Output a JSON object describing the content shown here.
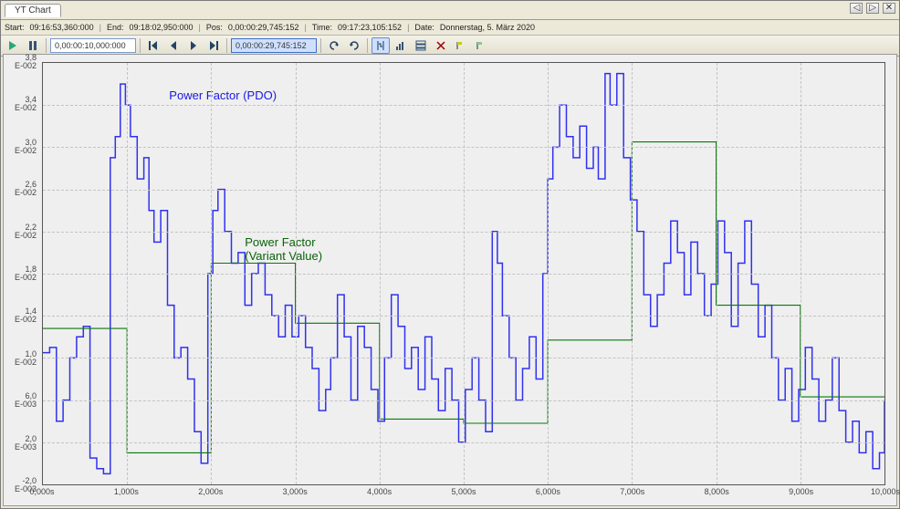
{
  "tab": {
    "title": "YT Chart"
  },
  "wincontrols": {
    "left": "◁",
    "right": "▷",
    "close": "✕"
  },
  "info": {
    "start_label": "Start:",
    "start_value": "09:16:53,360:000",
    "end_label": "End:",
    "end_value": "09:18:02,950:000",
    "pos_label": "Pos:",
    "pos_value": "0,00:00:29,745:152",
    "time_label": "Time:",
    "time_value": "09:17:23,105:152",
    "date_label": "Date:",
    "date_value": "Donnerstag, 5. März 2020"
  },
  "toolbar": {
    "field1": "0,00:00:10,000:000",
    "field2": "0,00:00:29,745:152",
    "icons": {
      "play": "run-icon",
      "pause": "pause-icon",
      "first": "goto-start-icon",
      "prev": "step-back-icon",
      "next": "step-fwd-icon",
      "last": "goto-end-icon",
      "undo": "undo-icon",
      "redo": "redo-icon",
      "cursor": "cursor-toggle-icon",
      "chart1": "overview-icon",
      "chart2": "stack-icon",
      "xmark": "clear-marks-icon",
      "tool1": "marker-a-icon",
      "tool2": "marker-b-icon"
    }
  },
  "annotations": {
    "pdo": "Power Factor (PDO)",
    "variant": "Power Factor\n(Variant Value)"
  },
  "chart_data": {
    "type": "line",
    "xlabel": "",
    "ylabel": "",
    "xlim": [
      0,
      10000
    ],
    "ylim": [
      -0.002,
      0.038
    ],
    "x_ticks": [
      "0,000s",
      "1,000s",
      "2,000s",
      "3,000s",
      "4,000s",
      "5,000s",
      "6,000s",
      "7,000s",
      "8,000s",
      "9,000s",
      "10,000s"
    ],
    "y_ticks": [
      "-2,0\nE-003",
      "2,0\nE-003",
      "6,0\nE-003",
      "1,0\nE-002",
      "1,4\nE-002",
      "1,8\nE-002",
      "2,2\nE-002",
      "2,6\nE-002",
      "3,0\nE-002",
      "3,4\nE-002",
      "3,8\nE-002"
    ],
    "y_tick_values": [
      -0.002,
      0.002,
      0.006,
      0.01,
      0.014,
      0.018,
      0.022,
      0.026,
      0.03,
      0.034,
      0.038
    ],
    "series": [
      {
        "name": "Power Factor (PDO)",
        "color": "#3030f0",
        "style": "step",
        "data": [
          [
            0,
            0.0105
          ],
          [
            80,
            0.011
          ],
          [
            160,
            0.004
          ],
          [
            240,
            0.006
          ],
          [
            320,
            0.01
          ],
          [
            400,
            0.012
          ],
          [
            480,
            0.013
          ],
          [
            560,
            0.0005
          ],
          [
            640,
            -0.0005
          ],
          [
            720,
            -0.001
          ],
          [
            800,
            0.029
          ],
          [
            860,
            0.031
          ],
          [
            920,
            0.036
          ],
          [
            980,
            0.034
          ],
          [
            1040,
            0.031
          ],
          [
            1120,
            0.027
          ],
          [
            1200,
            0.029
          ],
          [
            1260,
            0.024
          ],
          [
            1320,
            0.021
          ],
          [
            1400,
            0.024
          ],
          [
            1480,
            0.015
          ],
          [
            1560,
            0.01
          ],
          [
            1640,
            0.011
          ],
          [
            1720,
            0.008
          ],
          [
            1800,
            0.003
          ],
          [
            1880,
            0.0
          ],
          [
            1960,
            0.018
          ],
          [
            2020,
            0.024
          ],
          [
            2080,
            0.026
          ],
          [
            2160,
            0.022
          ],
          [
            2240,
            0.019
          ],
          [
            2320,
            0.02
          ],
          [
            2400,
            0.015
          ],
          [
            2480,
            0.018
          ],
          [
            2560,
            0.019
          ],
          [
            2640,
            0.016
          ],
          [
            2720,
            0.014
          ],
          [
            2800,
            0.012
          ],
          [
            2880,
            0.015
          ],
          [
            2960,
            0.012
          ],
          [
            3040,
            0.014
          ],
          [
            3120,
            0.011
          ],
          [
            3200,
            0.009
          ],
          [
            3280,
            0.005
          ],
          [
            3360,
            0.007
          ],
          [
            3420,
            0.01
          ],
          [
            3500,
            0.016
          ],
          [
            3580,
            0.012
          ],
          [
            3660,
            0.006
          ],
          [
            3740,
            0.013
          ],
          [
            3820,
            0.011
          ],
          [
            3900,
            0.007
          ],
          [
            3980,
            0.004
          ],
          [
            4060,
            0.01
          ],
          [
            4140,
            0.016
          ],
          [
            4220,
            0.013
          ],
          [
            4300,
            0.009
          ],
          [
            4380,
            0.011
          ],
          [
            4460,
            0.007
          ],
          [
            4540,
            0.012
          ],
          [
            4620,
            0.008
          ],
          [
            4700,
            0.005
          ],
          [
            4780,
            0.009
          ],
          [
            4860,
            0.006
          ],
          [
            4940,
            0.002
          ],
          [
            5020,
            0.007
          ],
          [
            5100,
            0.01
          ],
          [
            5180,
            0.006
          ],
          [
            5260,
            0.003
          ],
          [
            5340,
            0.022
          ],
          [
            5400,
            0.019
          ],
          [
            5460,
            0.014
          ],
          [
            5540,
            0.01
          ],
          [
            5620,
            0.006
          ],
          [
            5700,
            0.009
          ],
          [
            5780,
            0.012
          ],
          [
            5860,
            0.008
          ],
          [
            5940,
            0.018
          ],
          [
            6000,
            0.027
          ],
          [
            6060,
            0.03
          ],
          [
            6140,
            0.034
          ],
          [
            6220,
            0.031
          ],
          [
            6300,
            0.029
          ],
          [
            6380,
            0.032
          ],
          [
            6460,
            0.028
          ],
          [
            6540,
            0.03
          ],
          [
            6600,
            0.027
          ],
          [
            6680,
            0.037
          ],
          [
            6740,
            0.034
          ],
          [
            6820,
            0.037
          ],
          [
            6900,
            0.029
          ],
          [
            6980,
            0.025
          ],
          [
            7060,
            0.022
          ],
          [
            7140,
            0.016
          ],
          [
            7220,
            0.013
          ],
          [
            7300,
            0.016
          ],
          [
            7380,
            0.019
          ],
          [
            7460,
            0.023
          ],
          [
            7540,
            0.02
          ],
          [
            7620,
            0.016
          ],
          [
            7700,
            0.021
          ],
          [
            7780,
            0.018
          ],
          [
            7860,
            0.014
          ],
          [
            7940,
            0.017
          ],
          [
            8020,
            0.023
          ],
          [
            8100,
            0.02
          ],
          [
            8180,
            0.013
          ],
          [
            8260,
            0.019
          ],
          [
            8340,
            0.023
          ],
          [
            8420,
            0.017
          ],
          [
            8500,
            0.012
          ],
          [
            8580,
            0.015
          ],
          [
            8660,
            0.01
          ],
          [
            8740,
            0.006
          ],
          [
            8820,
            0.009
          ],
          [
            8900,
            0.004
          ],
          [
            8980,
            0.007
          ],
          [
            9060,
            0.011
          ],
          [
            9140,
            0.008
          ],
          [
            9220,
            0.004
          ],
          [
            9300,
            0.006
          ],
          [
            9380,
            0.01
          ],
          [
            9460,
            0.005
          ],
          [
            9540,
            0.002
          ],
          [
            9620,
            0.004
          ],
          [
            9700,
            0.001
          ],
          [
            9780,
            0.003
          ],
          [
            9860,
            -0.0005
          ],
          [
            9940,
            0.001
          ],
          [
            10000,
            0.006
          ]
        ]
      },
      {
        "name": "Power Factor (Variant Value)",
        "color": "#0a780a",
        "style": "step",
        "data": [
          [
            0,
            0.0128
          ],
          [
            1000,
            0.001
          ],
          [
            2000,
            0.019
          ],
          [
            3000,
            0.0133
          ],
          [
            4000,
            0.0042
          ],
          [
            5000,
            0.0038
          ],
          [
            6000,
            0.0117
          ],
          [
            7000,
            0.0305
          ],
          [
            8000,
            0.015
          ],
          [
            9000,
            0.0063
          ],
          [
            10000,
            0.0063
          ]
        ]
      }
    ]
  }
}
